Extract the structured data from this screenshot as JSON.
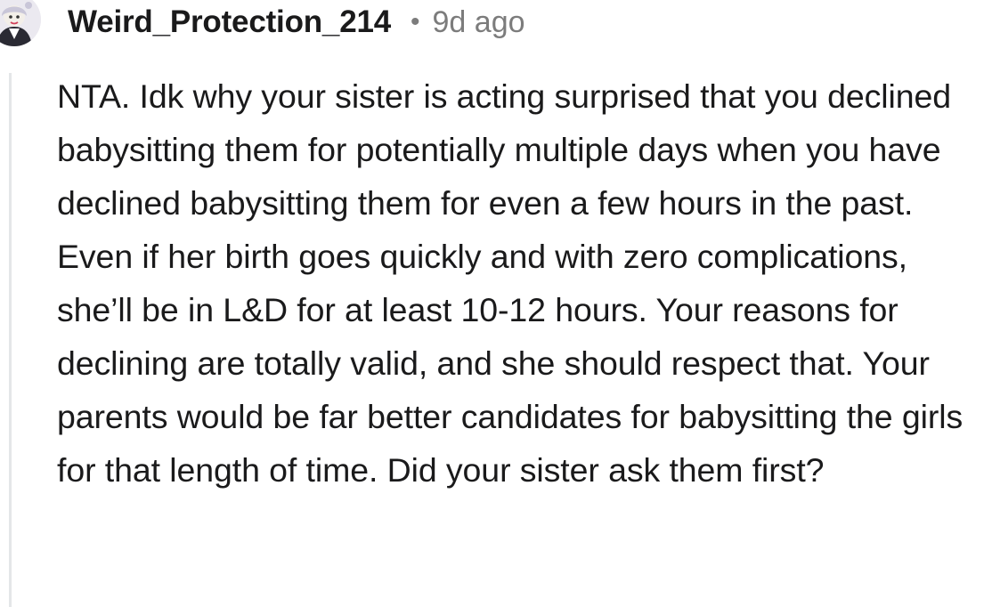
{
  "comment": {
    "author": "Weird_Protection_214",
    "separator": "•",
    "timestamp": "9d ago",
    "avatar_icon": "user-avatar-icon",
    "body": "NTA. Idk why your sister is acting surprised that you declined babysitting them for potentially multiple days when you have declined babysitting them for even a few hours in the past. Even if her birth goes quickly and with zero complications, she’ll be in L&D for at least 10-12 hours. Your reasons for declining are totally valid, and she should respect that. Your parents would be far better candidates for babysitting the girls for that length of time. Did your sister ask them first?"
  },
  "colors": {
    "text": "#1a1a1b",
    "meta": "#7c7c7c",
    "thread_line": "#e4e6e8"
  }
}
